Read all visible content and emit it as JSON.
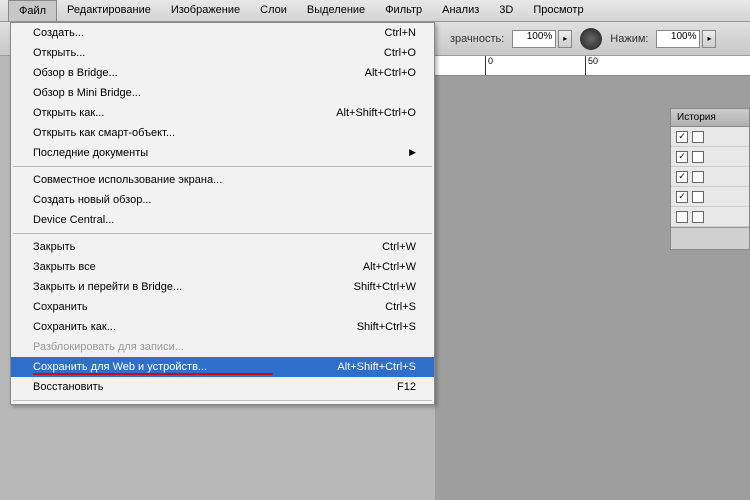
{
  "menubar": {
    "items": [
      "Файл",
      "Редактирование",
      "Изображение",
      "Слои",
      "Выделение",
      "Фильтр",
      "Анализ",
      "3D",
      "Просмотр"
    ],
    "active_index": 0
  },
  "toolbar": {
    "opacity_label": "зрачность:",
    "opacity_value": "100%",
    "pressure_label": "Нажим:",
    "pressure_value": "100%"
  },
  "ruler": {
    "ticks": [
      {
        "pos": 50,
        "label": "0"
      },
      {
        "pos": 150,
        "label": "50"
      }
    ]
  },
  "dropdown": {
    "items": [
      {
        "label": "Создать...",
        "shortcut": "Ctrl+N"
      },
      {
        "label": "Открыть...",
        "shortcut": "Ctrl+O"
      },
      {
        "label": "Обзор в Bridge...",
        "shortcut": "Alt+Ctrl+O"
      },
      {
        "label": "Обзор в Mini Bridge..."
      },
      {
        "label": "Открыть как...",
        "shortcut": "Alt+Shift+Ctrl+O"
      },
      {
        "label": "Открыть как смарт-объект..."
      },
      {
        "label": "Последние документы",
        "sub": true
      },
      {
        "sep": true
      },
      {
        "label": "Совместное использование экрана..."
      },
      {
        "label": "Создать новый обзор..."
      },
      {
        "label": "Device Central..."
      },
      {
        "sep": true
      },
      {
        "label": "Закрыть",
        "shortcut": "Ctrl+W"
      },
      {
        "label": "Закрыть все",
        "shortcut": "Alt+Ctrl+W"
      },
      {
        "label": "Закрыть и перейти в Bridge...",
        "shortcut": "Shift+Ctrl+W"
      },
      {
        "label": "Сохранить",
        "shortcut": "Ctrl+S"
      },
      {
        "label": "Сохранить как...",
        "shortcut": "Shift+Ctrl+S"
      },
      {
        "label": "Разблокировать для записи...",
        "disabled": true
      },
      {
        "label": "Сохранить для Web и устройств...",
        "shortcut": "Alt+Shift+Ctrl+S",
        "highlight": true
      },
      {
        "label": "Восстановить",
        "shortcut": "F12"
      },
      {
        "sep": true
      }
    ]
  },
  "panel": {
    "tab": "История",
    "rows": [
      {
        "checked": true
      },
      {
        "checked": true
      },
      {
        "checked": true
      },
      {
        "checked": true
      },
      {
        "checked": false
      }
    ]
  }
}
